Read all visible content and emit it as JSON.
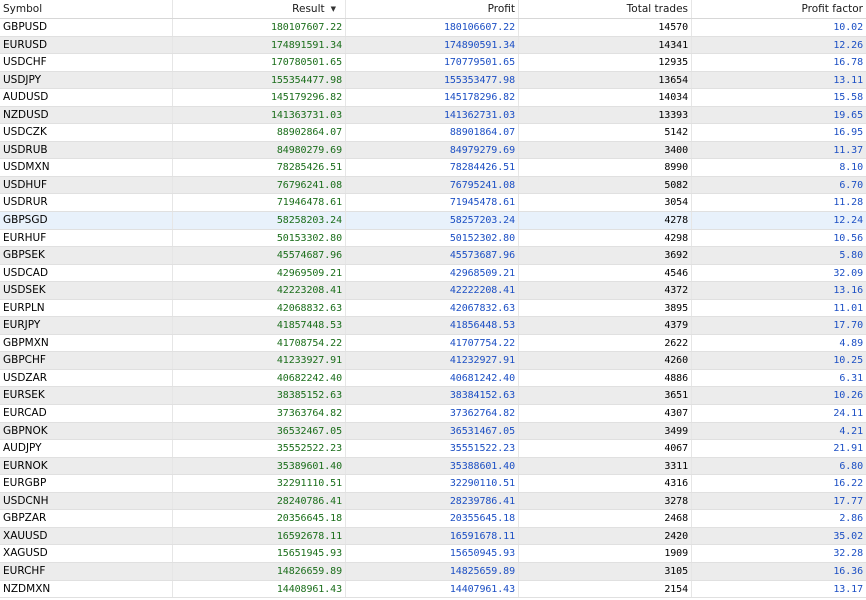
{
  "columns": {
    "symbol": "Symbol",
    "result": "Result",
    "profit": "Profit",
    "total_trades": "Total trades",
    "profit_factor": "Profit factor"
  },
  "sort_indicator": "▼",
  "selected_row": 11,
  "colors": {
    "result_text": "#1b6e1b",
    "profit_text": "#1c4fc4",
    "alt_row": "#ececec",
    "selected_row": "#e8f1fb"
  },
  "rows": [
    {
      "symbol": "GBPUSD",
      "result": "180107607.22",
      "profit": "180106607.22",
      "trades": "14570",
      "pf": "10.02"
    },
    {
      "symbol": "EURUSD",
      "result": "174891591.34",
      "profit": "174890591.34",
      "trades": "14341",
      "pf": "12.26"
    },
    {
      "symbol": "USDCHF",
      "result": "170780501.65",
      "profit": "170779501.65",
      "trades": "12935",
      "pf": "16.78"
    },
    {
      "symbol": "USDJPY",
      "result": "155354477.98",
      "profit": "155353477.98",
      "trades": "13654",
      "pf": "13.11"
    },
    {
      "symbol": "AUDUSD",
      "result": "145179296.82",
      "profit": "145178296.82",
      "trades": "14034",
      "pf": "15.58"
    },
    {
      "symbol": "NZDUSD",
      "result": "141363731.03",
      "profit": "141362731.03",
      "trades": "13393",
      "pf": "19.65"
    },
    {
      "symbol": "USDCZK",
      "result": "88902864.07",
      "profit": "88901864.07",
      "trades": "5142",
      "pf": "16.95"
    },
    {
      "symbol": "USDRUB",
      "result": "84980279.69",
      "profit": "84979279.69",
      "trades": "3400",
      "pf": "11.37"
    },
    {
      "symbol": "USDMXN",
      "result": "78285426.51",
      "profit": "78284426.51",
      "trades": "8990",
      "pf": "8.10"
    },
    {
      "symbol": "USDHUF",
      "result": "76796241.08",
      "profit": "76795241.08",
      "trades": "5082",
      "pf": "6.70"
    },
    {
      "symbol": "USDRUR",
      "result": "71946478.61",
      "profit": "71945478.61",
      "trades": "3054",
      "pf": "11.28"
    },
    {
      "symbol": "GBPSGD",
      "result": "58258203.24",
      "profit": "58257203.24",
      "trades": "4278",
      "pf": "12.24"
    },
    {
      "symbol": "EURHUF",
      "result": "50153302.80",
      "profit": "50152302.80",
      "trades": "4298",
      "pf": "10.56"
    },
    {
      "symbol": "GBPSEK",
      "result": "45574687.96",
      "profit": "45573687.96",
      "trades": "3692",
      "pf": "5.80"
    },
    {
      "symbol": "USDCAD",
      "result": "42969509.21",
      "profit": "42968509.21",
      "trades": "4546",
      "pf": "32.09"
    },
    {
      "symbol": "USDSEK",
      "result": "42223208.41",
      "profit": "42222208.41",
      "trades": "4372",
      "pf": "13.16"
    },
    {
      "symbol": "EURPLN",
      "result": "42068832.63",
      "profit": "42067832.63",
      "trades": "3895",
      "pf": "11.01"
    },
    {
      "symbol": "EURJPY",
      "result": "41857448.53",
      "profit": "41856448.53",
      "trades": "4379",
      "pf": "17.70"
    },
    {
      "symbol": "GBPMXN",
      "result": "41708754.22",
      "profit": "41707754.22",
      "trades": "2622",
      "pf": "4.89"
    },
    {
      "symbol": "GBPCHF",
      "result": "41233927.91",
      "profit": "41232927.91",
      "trades": "4260",
      "pf": "10.25"
    },
    {
      "symbol": "USDZAR",
      "result": "40682242.40",
      "profit": "40681242.40",
      "trades": "4886",
      "pf": "6.31"
    },
    {
      "symbol": "EURSEK",
      "result": "38385152.63",
      "profit": "38384152.63",
      "trades": "3651",
      "pf": "10.26"
    },
    {
      "symbol": "EURCAD",
      "result": "37363764.82",
      "profit": "37362764.82",
      "trades": "4307",
      "pf": "24.11"
    },
    {
      "symbol": "GBPNOK",
      "result": "36532467.05",
      "profit": "36531467.05",
      "trades": "3499",
      "pf": "4.21"
    },
    {
      "symbol": "AUDJPY",
      "result": "35552522.23",
      "profit": "35551522.23",
      "trades": "4067",
      "pf": "21.91"
    },
    {
      "symbol": "EURNOK",
      "result": "35389601.40",
      "profit": "35388601.40",
      "trades": "3311",
      "pf": "6.80"
    },
    {
      "symbol": "EURGBP",
      "result": "32291110.51",
      "profit": "32290110.51",
      "trades": "4316",
      "pf": "16.22"
    },
    {
      "symbol": "USDCNH",
      "result": "28240786.41",
      "profit": "28239786.41",
      "trades": "3278",
      "pf": "17.77"
    },
    {
      "symbol": "GBPZAR",
      "result": "20356645.18",
      "profit": "20355645.18",
      "trades": "2468",
      "pf": "2.86"
    },
    {
      "symbol": "XAUUSD",
      "result": "16592678.11",
      "profit": "16591678.11",
      "trades": "2420",
      "pf": "35.02"
    },
    {
      "symbol": "XAGUSD",
      "result": "15651945.93",
      "profit": "15650945.93",
      "trades": "1909",
      "pf": "32.28"
    },
    {
      "symbol": "EURCHF",
      "result": "14826659.89",
      "profit": "14825659.89",
      "trades": "3105",
      "pf": "16.36"
    },
    {
      "symbol": "NZDMXN",
      "result": "14408961.43",
      "profit": "14407961.43",
      "trades": "2154",
      "pf": "13.17"
    }
  ]
}
